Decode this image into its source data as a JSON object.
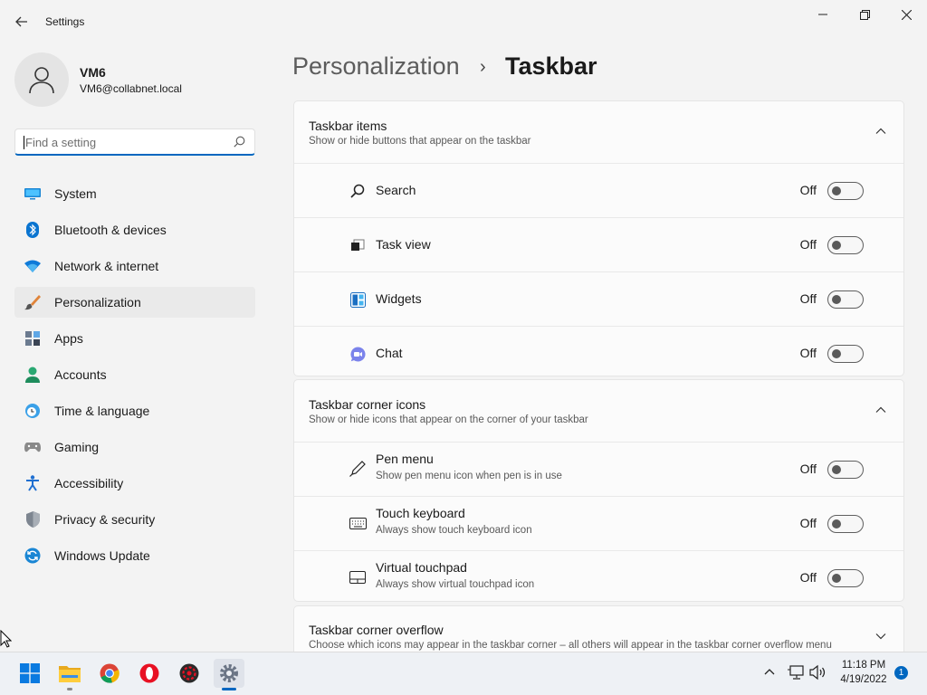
{
  "app": {
    "title": "Settings"
  },
  "window_controls": {
    "minimize": "—",
    "maximize": "❐",
    "close": "✕"
  },
  "user": {
    "name": "VM6",
    "email": "VM6@collabnet.local"
  },
  "search": {
    "placeholder": "Find a setting",
    "value": ""
  },
  "nav": {
    "items": [
      {
        "label": "System",
        "icon": "system-icon"
      },
      {
        "label": "Bluetooth & devices",
        "icon": "bluetooth-icon"
      },
      {
        "label": "Network & internet",
        "icon": "network-icon"
      },
      {
        "label": "Personalization",
        "icon": "personalization-brush-icon",
        "active": true
      },
      {
        "label": "Apps",
        "icon": "apps-icon"
      },
      {
        "label": "Accounts",
        "icon": "accounts-icon"
      },
      {
        "label": "Time & language",
        "icon": "time-language-icon"
      },
      {
        "label": "Gaming",
        "icon": "gaming-icon"
      },
      {
        "label": "Accessibility",
        "icon": "accessibility-icon"
      },
      {
        "label": "Privacy & security",
        "icon": "privacy-shield-icon"
      },
      {
        "label": "Windows Update",
        "icon": "windows-update-icon"
      }
    ]
  },
  "breadcrumb": {
    "parent": "Personalization",
    "separator": "›",
    "current": "Taskbar"
  },
  "sections": {
    "taskbar_items": {
      "title": "Taskbar items",
      "subtitle": "Show or hide buttons that appear on the taskbar",
      "expanded": true,
      "rows": [
        {
          "label": "Search",
          "state": "Off",
          "icon": "search-icon"
        },
        {
          "label": "Task view",
          "state": "Off",
          "icon": "task-view-icon"
        },
        {
          "label": "Widgets",
          "state": "Off",
          "icon": "widgets-icon"
        },
        {
          "label": "Chat",
          "state": "Off",
          "icon": "chat-icon"
        }
      ]
    },
    "corner_icons": {
      "title": "Taskbar corner icons",
      "subtitle": "Show or hide icons that appear on the corner of your taskbar",
      "expanded": true,
      "rows": [
        {
          "label": "Pen menu",
          "desc": "Show pen menu icon when pen is in use",
          "state": "Off",
          "icon": "pen-icon"
        },
        {
          "label": "Touch keyboard",
          "desc": "Always show touch keyboard icon",
          "state": "Off",
          "icon": "keyboard-icon"
        },
        {
          "label": "Virtual touchpad",
          "desc": "Always show virtual touchpad icon",
          "state": "Off",
          "icon": "touchpad-icon"
        }
      ]
    },
    "corner_overflow": {
      "title": "Taskbar corner overflow",
      "subtitle": "Choose which icons may appear in the taskbar corner – all others will appear in the taskbar corner overflow menu",
      "expanded": false
    }
  },
  "taskbar": {
    "apps": [
      "start-icon",
      "file-explorer-icon",
      "chrome-icon",
      "opera-icon",
      "app-icon",
      "settings-gear-icon"
    ],
    "time": "11:18 PM",
    "date": "4/19/2022",
    "notification_count": "1"
  },
  "colors": {
    "accent": "#0067c0",
    "background": "#f3f3f3",
    "card": "#fbfbfb"
  }
}
